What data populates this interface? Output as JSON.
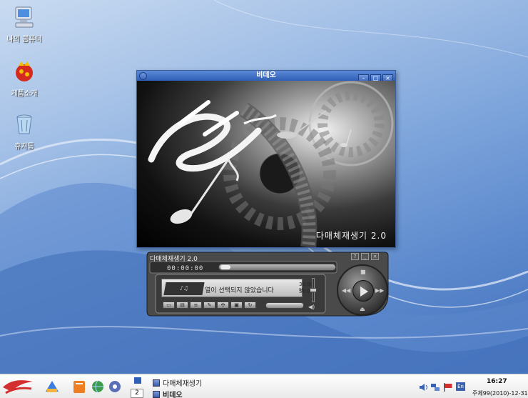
{
  "desktop": {
    "icons": [
      {
        "label": "나의 콤퓨터",
        "icon": "computer-icon"
      },
      {
        "label": "제품소개",
        "icon": "product-intro-icon"
      },
      {
        "label": "휴지통",
        "icon": "trash-icon"
      }
    ]
  },
  "video_window": {
    "title": "비데오",
    "controls": [
      "minimize",
      "maximize",
      "close"
    ],
    "splash_caption": "다매체재생기 2.0"
  },
  "player": {
    "title": "다매체재생기 2.0",
    "title_controls": [
      "?",
      "_",
      "×"
    ],
    "time": "00:00:00",
    "status": "열이 선택되지 않았습니다",
    "rate_a": "30.00 %",
    "rate_b": "50.0",
    "seek_position": 0.0,
    "volume_level": 0.5
  },
  "taskbar": {
    "desktop_number": "2",
    "tasks": [
      {
        "label": "다매체재생기",
        "icon": "media-player-icon"
      },
      {
        "label": "비데오",
        "icon": "video-icon"
      }
    ],
    "clock_time": "16:27",
    "clock_date": "주체99(2010)-12-31",
    "tray_icons": [
      "volume-icon",
      "network-icon",
      "flag-icon",
      "keyboard-layout-icon"
    ],
    "keyboard_layout": "En",
    "colors": {
      "taskbar_bg": "#f2f2f2",
      "title_blue": "#2f5fb6"
    }
  }
}
